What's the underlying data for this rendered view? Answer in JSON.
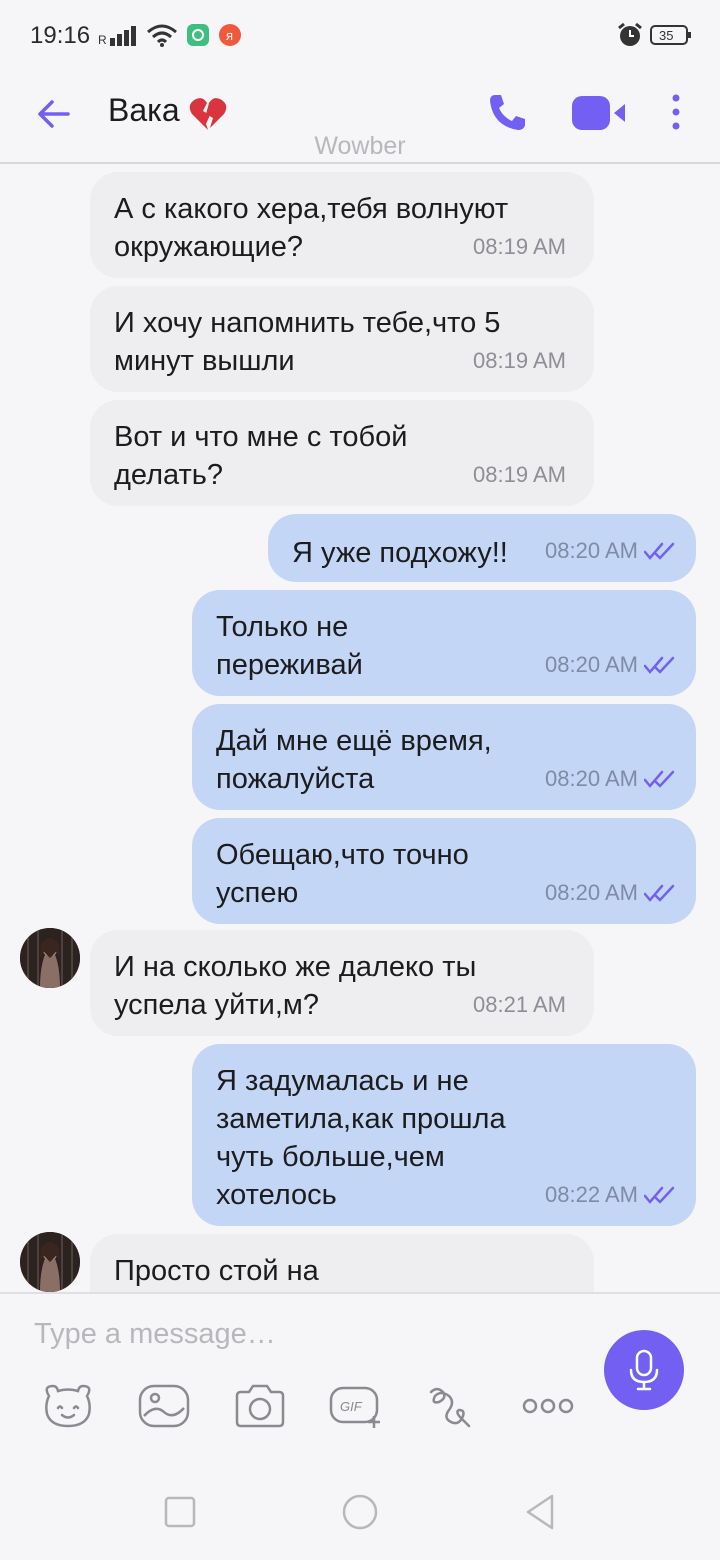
{
  "status_bar": {
    "time": "19:16",
    "signal_label": "R",
    "battery": "35"
  },
  "header": {
    "title": "Вака",
    "watermark": "Wowber"
  },
  "messages": [
    {
      "dir": "in",
      "text": "А с какого хера,тебя волнуют\nокружающие?",
      "time": "08:19 AM"
    },
    {
      "dir": "in",
      "text": "И хочу напомнить тебе,что 5\nминут вышли",
      "time": "08:19 AM"
    },
    {
      "dir": "in",
      "text": "Вот и что мне с тобой\nделать?",
      "time": "08:19 AM"
    },
    {
      "dir": "out",
      "text": "Я уже подхожу!!",
      "time": "08:20 AM"
    },
    {
      "dir": "out",
      "text": "Только не\nпереживай",
      "time": "08:20 AM"
    },
    {
      "dir": "out",
      "text": "Дай мне ещё время,\nпожалуйста",
      "time": "08:20 AM"
    },
    {
      "dir": "out",
      "text": "Обещаю,что точно\nуспею",
      "time": "08:20 AM"
    },
    {
      "dir": "in",
      "text": "И на сколько же далеко ты\nуспела уйти,м?",
      "time": "08:21 AM",
      "avatar": true
    },
    {
      "dir": "out",
      "text": "Я задумалась и не\nзаметила,как прошла\nчуть больше,чем\nхотелось",
      "time": "08:22 AM"
    },
    {
      "dir": "in",
      "text": "Просто стой на",
      "time": "",
      "avatar": true
    }
  ],
  "composer": {
    "placeholder": "Type a message…"
  },
  "colors": {
    "accent": "#7360f2",
    "incoming_bubble": "#eeedf0",
    "outgoing_bubble": "#c3d6f5"
  }
}
